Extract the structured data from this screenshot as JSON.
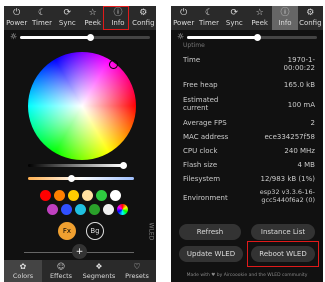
{
  "nav_tabs": [
    {
      "icon": "power-icon",
      "glyph": "⏻",
      "label": "Power"
    },
    {
      "icon": "moon-icon",
      "glyph": "☾",
      "label": "Timer"
    },
    {
      "icon": "sync-icon",
      "glyph": "⟳",
      "label": "Sync"
    },
    {
      "icon": "star-icon",
      "glyph": "☆",
      "label": "Peek"
    },
    {
      "icon": "info-icon",
      "glyph": "ⓘ",
      "label": "Info"
    },
    {
      "icon": "gear-icon",
      "glyph": "⚙",
      "label": "Config"
    }
  ],
  "left": {
    "swatch_colors": [
      "#ff0000",
      "#ff8000",
      "#ffcc00",
      "#ffe0a0",
      "#2ecc40",
      "#ffffff",
      "#c040c0",
      "#3050ff",
      "#20c0e0",
      "#2aa02a",
      "#f0f0f0"
    ],
    "fx_label": "Fx",
    "bg_label": "Bg",
    "add_label": "+",
    "side_label": "WLED",
    "bottom_tabs": [
      {
        "icon": "palette-icon",
        "glyph": "✿",
        "label": "Colors"
      },
      {
        "icon": "effects-icon",
        "glyph": "☺",
        "label": "Effects"
      },
      {
        "icon": "segments-icon",
        "glyph": "❖",
        "label": "Segments"
      },
      {
        "icon": "presets-icon",
        "glyph": "♡",
        "label": "Presets"
      }
    ]
  },
  "right": {
    "partial_top": "Uptime",
    "rows": [
      {
        "label": "Time",
        "value": "1970-1-\n00:00:22"
      },
      {
        "label": "Free heap",
        "value": "165.0 kB"
      },
      {
        "label": "Estimated\ncurrent",
        "value": "100 mA"
      },
      {
        "label": "Average FPS",
        "value": "2"
      },
      {
        "label": "MAC address",
        "value": "ece334257f58"
      },
      {
        "label": "CPU clock",
        "value": "240 MHz"
      },
      {
        "label": "Flash size",
        "value": "4 MB"
      },
      {
        "label": "Filesystem",
        "value": "12/983 kB (1%)"
      },
      {
        "label": "Environment",
        "value": "esp32 v3.3.6-16-\ngcc5440f6a2 (0)"
      }
    ],
    "refresh_label": "Refresh",
    "instance_list_label": "Instance List",
    "update_label": "Update WLED",
    "reboot_label": "Reboot WLED",
    "footer": "Made with ♥ by Aircoookie and the WLED community"
  }
}
